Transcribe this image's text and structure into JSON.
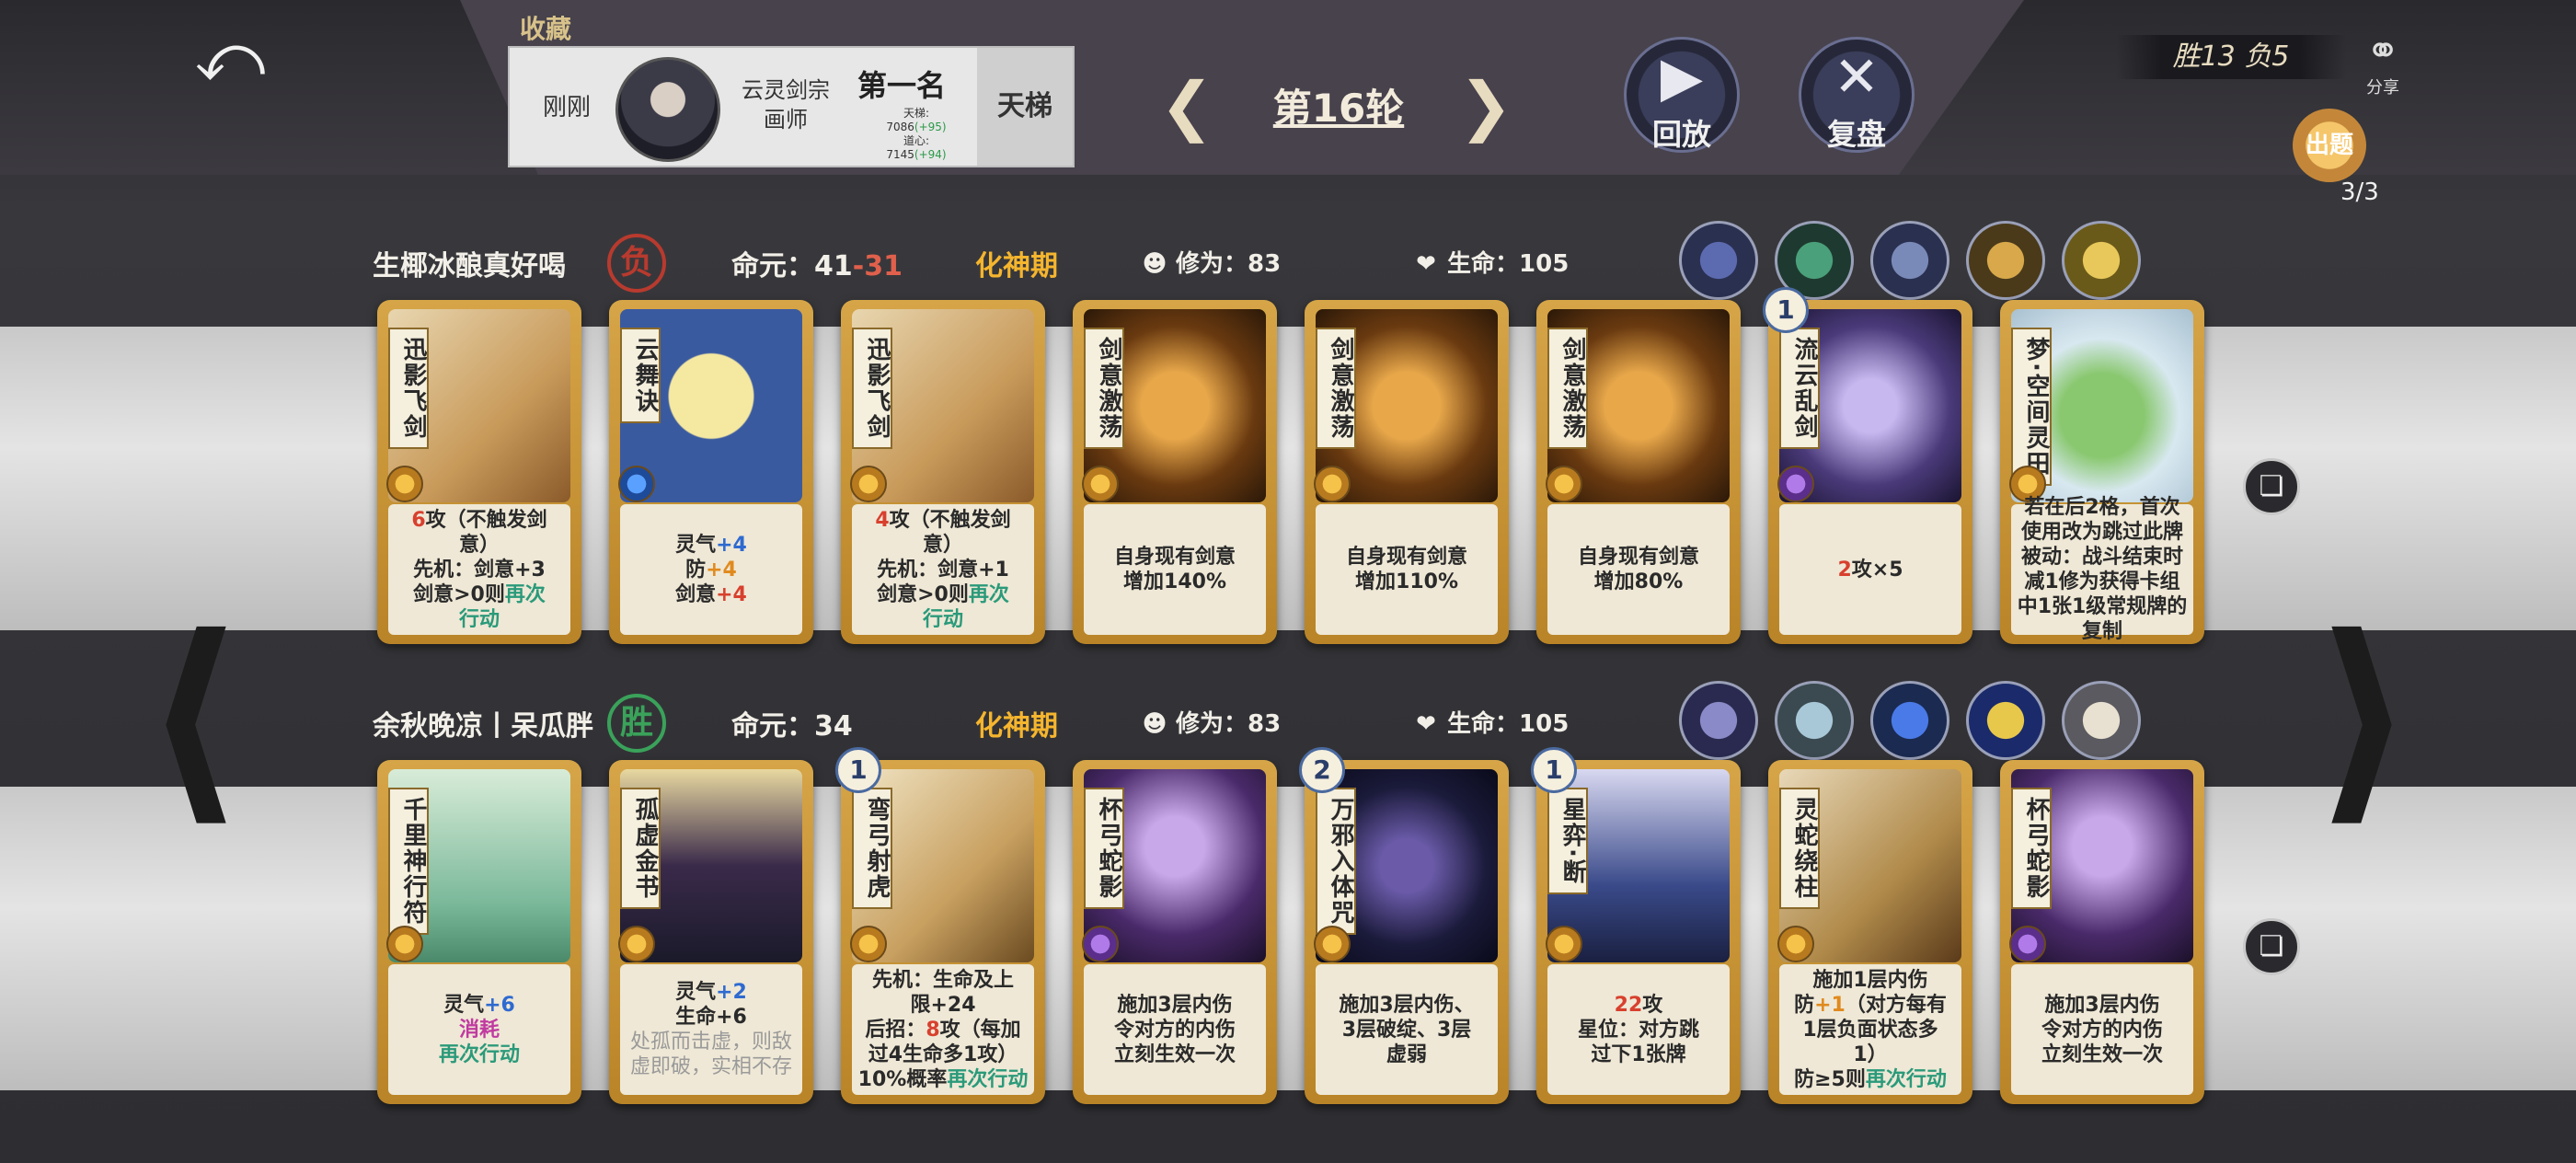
{
  "header": {
    "collect_title": "收藏",
    "collect": {
      "time": "刚刚",
      "sect_line1": "云灵剑宗",
      "sect_line2": "画师",
      "rank": "第一名",
      "ladder_label": "天梯:",
      "ladder_value": "7086",
      "ladder_delta": "(+95)",
      "mind_label": "道心:",
      "mind_value": "7145",
      "mind_delta": "(+94)",
      "mode": "天梯"
    },
    "round": "第16轮",
    "replay_label": "回放",
    "review_label": "复盘",
    "record": "胜13 负5",
    "share_label": "分享",
    "quiz_label": "出题",
    "quiz_count": "3/3"
  },
  "players": [
    {
      "name": "生椰冰酿真好喝",
      "result": "负",
      "life_label": "命元：",
      "life_value": "41",
      "life_delta": "-31",
      "realm": "化神期",
      "cult_label": "修为：",
      "cult_value": "83",
      "hp_label": "生命：",
      "hp_value": "105",
      "relics": [
        "relic-character-portrait",
        "relic-sword-slash",
        "relic-character-portrait",
        "relic-golden-blades",
        "relic-golden-cross"
      ],
      "cards": [
        {
          "title": "迅影飞剑",
          "gem": "gold",
          "level": "",
          "desc": [
            [
              [
                "6",
                "r"
              ],
              [
                "攻（不触发剑",
                ""
              ]
            ],
            [
              [
                "意）",
                ""
              ]
            ],
            [
              [
                "先机：剑意+3",
                ""
              ]
            ],
            [
              [
                "剑意>0则",
                ""
              ],
              [
                "再次",
                "gr"
              ]
            ],
            [
              [
                "行动",
                "gr"
              ]
            ]
          ]
        },
        {
          "title": "云舞诀",
          "gem": "blue",
          "level": "",
          "desc": [
            [
              [
                "灵气",
                ""
              ],
              [
                "+4",
                "b"
              ]
            ],
            [
              [
                "防",
                ""
              ],
              [
                "+4",
                "o"
              ]
            ],
            [
              [
                "剑意",
                ""
              ],
              [
                "+4",
                "r"
              ]
            ]
          ]
        },
        {
          "title": "迅影飞剑",
          "gem": "gold",
          "level": "",
          "desc": [
            [
              [
                "4",
                "r"
              ],
              [
                "攻（不触发剑",
                ""
              ]
            ],
            [
              [
                "意）",
                ""
              ]
            ],
            [
              [
                "先机：剑意+1",
                ""
              ]
            ],
            [
              [
                "剑意>0则",
                ""
              ],
              [
                "再次",
                "gr"
              ]
            ],
            [
              [
                "行动",
                "gr"
              ]
            ]
          ]
        },
        {
          "title": "剑意激荡",
          "gem": "gold",
          "level": "",
          "desc": [
            [
              [
                "自身现有剑意",
                ""
              ]
            ],
            [
              [
                "增加140%",
                ""
              ]
            ]
          ]
        },
        {
          "title": "剑意激荡",
          "gem": "gold",
          "level": "",
          "desc": [
            [
              [
                "自身现有剑意",
                ""
              ]
            ],
            [
              [
                "增加110%",
                ""
              ]
            ]
          ]
        },
        {
          "title": "剑意激荡",
          "gem": "gold",
          "level": "",
          "desc": [
            [
              [
                "自身现有剑意",
                ""
              ]
            ],
            [
              [
                "增加80%",
                ""
              ]
            ]
          ]
        },
        {
          "title": "流云乱剑",
          "gem": "purple",
          "level": "1",
          "desc": [
            [
              [
                "2",
                "r"
              ],
              [
                "攻×5",
                ""
              ]
            ]
          ]
        },
        {
          "title": "梦·空间灵田",
          "gem": "gold",
          "level": "",
          "desc": [
            [
              [
                "若在后2格，首次",
                ""
              ]
            ],
            [
              [
                "使用改为跳过此牌",
                ""
              ]
            ],
            [
              [
                "被动：战斗结束时",
                ""
              ]
            ],
            [
              [
                "减1修为获得卡组",
                ""
              ]
            ],
            [
              [
                "中1张1级常规牌的",
                ""
              ]
            ],
            [
              [
                "复制",
                ""
              ]
            ]
          ]
        }
      ]
    },
    {
      "name": "余秋晚凉丨呆瓜胖",
      "result": "胜",
      "life_label": "命元：",
      "life_value": "34",
      "life_delta": "",
      "realm": "化神期",
      "cult_label": "修为：",
      "cult_value": "83",
      "hp_label": "生命：",
      "hp_value": "105",
      "relics": [
        "relic-scroll",
        "relic-talisman",
        "relic-eye-orb",
        "relic-yin-yang",
        "relic-character-portrait"
      ],
      "cards": [
        {
          "title": "千里神行符",
          "gem": "gold",
          "level": "",
          "desc": [
            [
              [
                "灵气",
                ""
              ],
              [
                "+6",
                "b"
              ]
            ],
            [
              [
                "消耗",
                "m"
              ]
            ],
            [
              [
                "再次行动",
                "gr"
              ]
            ]
          ]
        },
        {
          "title": "孤虚金书",
          "gem": "gold",
          "level": "",
          "desc": [
            [
              [
                "灵气",
                ""
              ],
              [
                "+2",
                "b"
              ]
            ],
            [
              [
                "生命+6",
                ""
              ]
            ],
            [
              [
                "处孤而击虚，则敌",
                "gy"
              ]
            ],
            [
              [
                "虚即破，实相不存",
                "gy"
              ]
            ]
          ]
        },
        {
          "title": "弯弓射虎",
          "gem": "gold",
          "level": "1",
          "desc": [
            [
              [
                "先机：生命及上",
                ""
              ]
            ],
            [
              [
                "限+24",
                ""
              ]
            ],
            [
              [
                "后招：",
                ""
              ],
              [
                "8",
                "r"
              ],
              [
                "攻（每加",
                ""
              ]
            ],
            [
              [
                "过4生命多1攻）",
                ""
              ]
            ],
            [
              [
                "10%概率",
                ""
              ],
              [
                "再次行动",
                "gr"
              ]
            ]
          ]
        },
        {
          "title": "杯弓蛇影",
          "gem": "purple",
          "level": "",
          "desc": [
            [
              [
                "施加3层内伤",
                ""
              ]
            ],
            [
              [
                "令对方的内伤",
                ""
              ]
            ],
            [
              [
                "立刻生效一次",
                ""
              ]
            ]
          ]
        },
        {
          "title": "万邪入体咒",
          "gem": "gold",
          "level": "2",
          "desc": [
            [
              [
                "施加3层内伤、",
                ""
              ]
            ],
            [
              [
                "3层破绽、3层",
                ""
              ]
            ],
            [
              [
                "虚弱",
                ""
              ]
            ]
          ]
        },
        {
          "title": "星弈·断",
          "gem": "gold",
          "level": "1",
          "desc": [
            [
              [
                "22",
                "r"
              ],
              [
                "攻",
                ""
              ]
            ],
            [
              [
                "星位：对方跳",
                ""
              ]
            ],
            [
              [
                "过下1张牌",
                ""
              ]
            ]
          ]
        },
        {
          "title": "灵蛇绕柱",
          "gem": "gold",
          "level": "",
          "desc": [
            [
              [
                "施加1层内伤",
                ""
              ]
            ],
            [
              [
                "防",
                ""
              ],
              [
                "+1",
                "o"
              ],
              [
                "（对方每有",
                ""
              ]
            ],
            [
              [
                "1层负面状态多",
                ""
              ]
            ],
            [
              [
                "1）",
                ""
              ]
            ],
            [
              [
                "防≥5则",
                ""
              ],
              [
                "再次行动",
                "gr"
              ]
            ]
          ]
        },
        {
          "title": "杯弓蛇影",
          "gem": "purple",
          "level": "",
          "desc": [
            [
              [
                "施加3层内伤",
                ""
              ]
            ],
            [
              [
                "令对方的内伤",
                ""
              ]
            ],
            [
              [
                "立刻生效一次",
                ""
              ]
            ]
          ]
        }
      ]
    }
  ],
  "colors": {
    "card_frame": "#d6a547",
    "realm": "#f5b52e",
    "lose": "#b83a2e",
    "win": "#3aa25a"
  }
}
